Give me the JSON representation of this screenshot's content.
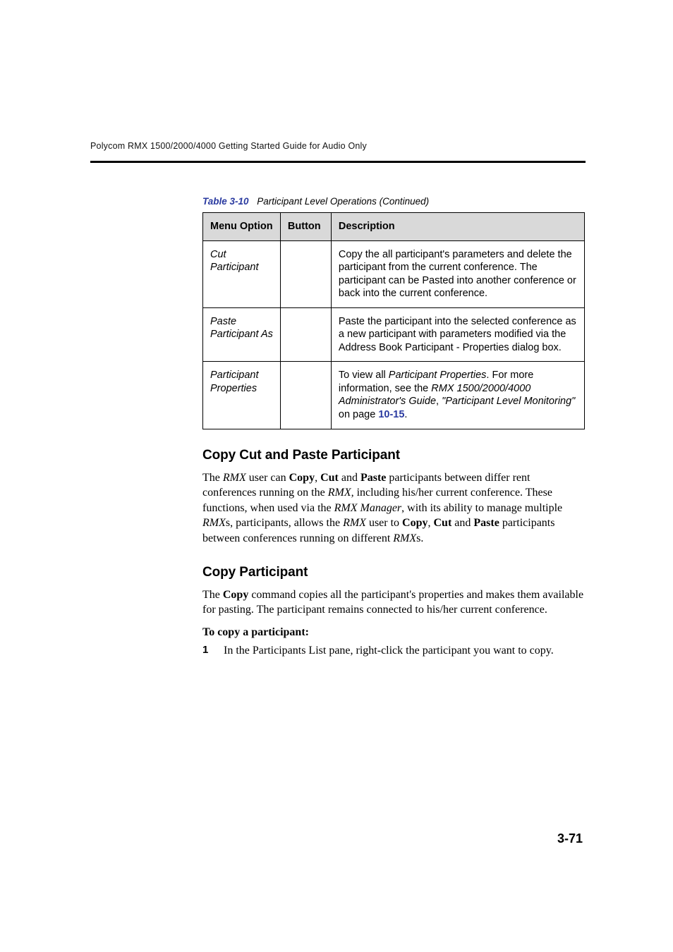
{
  "running_head": "Polycom RMX 1500/2000/4000 Getting Started Guide for Audio Only",
  "table": {
    "caption_id": "Table 3-10",
    "caption_text": "Participant Level Operations (Continued)",
    "headers": {
      "menu": "Menu Option",
      "button": "Button",
      "desc": "Description"
    },
    "rows": [
      {
        "menu": "Cut Participant",
        "button": "",
        "desc": "Copy the all participant's parameters and delete the participant from the current conference. The participant can be Pasted into another conference or back into the current conference."
      },
      {
        "menu": "Paste Participant As",
        "button": "",
        "desc": "Paste the participant into the selected conference as a new participant with parameters modified via the Address Book Participant - Properties dialog box."
      },
      {
        "menu": "Participant Properties",
        "button": "",
        "desc_prefix": "To view all ",
        "desc_em1": "Participant Properties",
        "desc_mid1": ".\nFor more information, see the ",
        "desc_em2": "RMX 1500/2000/4000 Administrator's Guide",
        "desc_mid2": ", ",
        "desc_em3": "\"Participant Level Monitoring\"",
        "desc_mid3": " on page ",
        "desc_link": "10-15",
        "desc_suffix": "."
      }
    ]
  },
  "sections": {
    "copy_cut_paste": {
      "heading": "Copy Cut and Paste Participant",
      "p1_a": "The ",
      "p1_i1": "RMX",
      "p1_b": " user can ",
      "p1_bold1": "Copy",
      "p1_c": ", ",
      "p1_bold2": "Cut",
      "p1_d": " and ",
      "p1_bold3": "Paste",
      "p1_e": " participants between differ rent conferences running on the ",
      "p1_i2": "RMX,",
      "p1_f": " including his/her current conference. These functions, when used via the ",
      "p1_i3": "RMX Manager",
      "p1_g": ", with its ability to manage multiple ",
      "p1_i4": "RMX",
      "p1_h": "s, participants, allows the ",
      "p1_i5": "RMX",
      "p1_i": " user to ",
      "p1_bold4": "Copy",
      "p1_j": ", ",
      "p1_bold5": "Cut",
      "p1_k": " and ",
      "p1_bold6": "Paste",
      "p1_l": " participants between conferences running on different ",
      "p1_i6": "RMX",
      "p1_m": "s."
    },
    "copy_participant": {
      "heading": "Copy Participant",
      "p1_a": "The ",
      "p1_bold": "Copy",
      "p1_b": " command copies all the participant's properties and makes them available for pasting. The participant remains connected to his/her current conference.",
      "lead": "To copy a participant:",
      "step1_num": "1",
      "step1_a": "In the ",
      "step1_i": "Participants List",
      "step1_b": " pane, right-click the participant you want to copy."
    }
  },
  "page_number": "3-71"
}
